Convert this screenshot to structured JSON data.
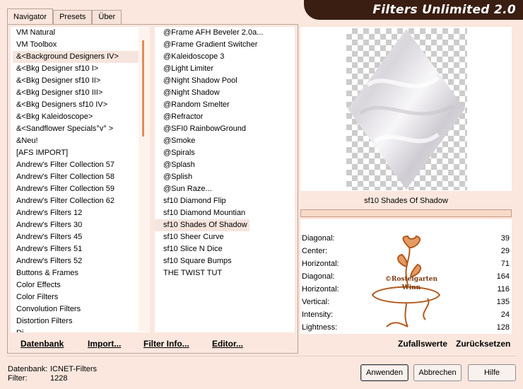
{
  "title": "Filters Unlimited 2.0",
  "tabs": [
    {
      "label": "Navigator"
    },
    {
      "label": "Presets"
    },
    {
      "label": "Über"
    }
  ],
  "categories": [
    "VM Natural",
    "VM Toolbox",
    "&<Background Designers IV>",
    "&<Bkg Designer sf10 I>",
    "&<Bkg Designer sf10 II>",
    "&<Bkg Designer sf10 III>",
    "&<Bkg Designers sf10 IV>",
    "&<Bkg Kaleidoscope>",
    "&<Sandflower Specials°v° >",
    "&Neu!",
    "[AFS IMPORT]",
    "Andrew's Filter Collection 57",
    "Andrew's Filter Collection 58",
    "Andrew's Filter Collection 59",
    "Andrew's Filter Collection 62",
    "Andrew's Filters 12",
    "Andrew's Filters 30",
    "Andrew's Filters 45",
    "Andrew's Filters 51",
    "Andrew's Filters 52",
    "Buttons & Frames",
    "Color Effects",
    "Color Filters",
    "Convolution Filters",
    "Distortion Filters",
    "Di..."
  ],
  "selected_category": "&<Background Designers IV>",
  "filters": [
    "@Frame AFH Beveler 2.0a...",
    "@Frame Gradient Switcher",
    "@Kaleidoscope 3",
    "@Light Limiter",
    "@Night Shadow Pool",
    "@Night Shadow",
    "@Random Smelter",
    "@Refractor",
    "@SFI0 RainbowGround",
    "@Smoke",
    "@Spirals",
    "@Splash",
    "@Splish",
    "@Sun Raze...",
    "sf10 Diamond Flip",
    "sf10 Diamond Mountian",
    "sf10 Shades Of Shadow",
    "sf10 Sheer Curve",
    "sf10 Slice N Dice",
    "sf10 Square Bumps",
    "THE TWIST TUT"
  ],
  "selected_filter": "sf10 Shades Of Shadow",
  "preview_filter_name": "sf10 Shades Of Shadow",
  "parameters": [
    {
      "label": "Diagonal:",
      "value": "39"
    },
    {
      "label": "Center:",
      "value": "29"
    },
    {
      "label": "Horizontal:",
      "value": "71"
    },
    {
      "label": "Diagonal:",
      "value": "164"
    },
    {
      "label": "Horizontal:",
      "value": "116"
    },
    {
      "label": "Vertical:",
      "value": "135"
    },
    {
      "label": "Intensity:",
      "value": "24"
    },
    {
      "label": "Lightness:",
      "value": "128"
    }
  ],
  "watermark": {
    "line1": "©Rosteigarten",
    "line2": "Winn"
  },
  "buttons": {
    "datenbank": "Datenbank",
    "import": "Import...",
    "filter_info": "Filter Info...",
    "editor": "Editor...",
    "zufallswerte": "Zufallswerte",
    "zuruecksetzen": "Zurücksetzen",
    "anwenden": "Anwenden",
    "abbrechen": "Abbrechen",
    "hilfe": "Hilfe"
  },
  "status": {
    "db_label": "Datenbank:",
    "db_value": "ICNET-Filters",
    "filter_label": "Filter:",
    "filter_value": "1228"
  },
  "colors": {
    "background": "#fbe7de",
    "banner": "#3a1e12",
    "accent": "#e08c5c",
    "selection": "#f6e5de"
  }
}
